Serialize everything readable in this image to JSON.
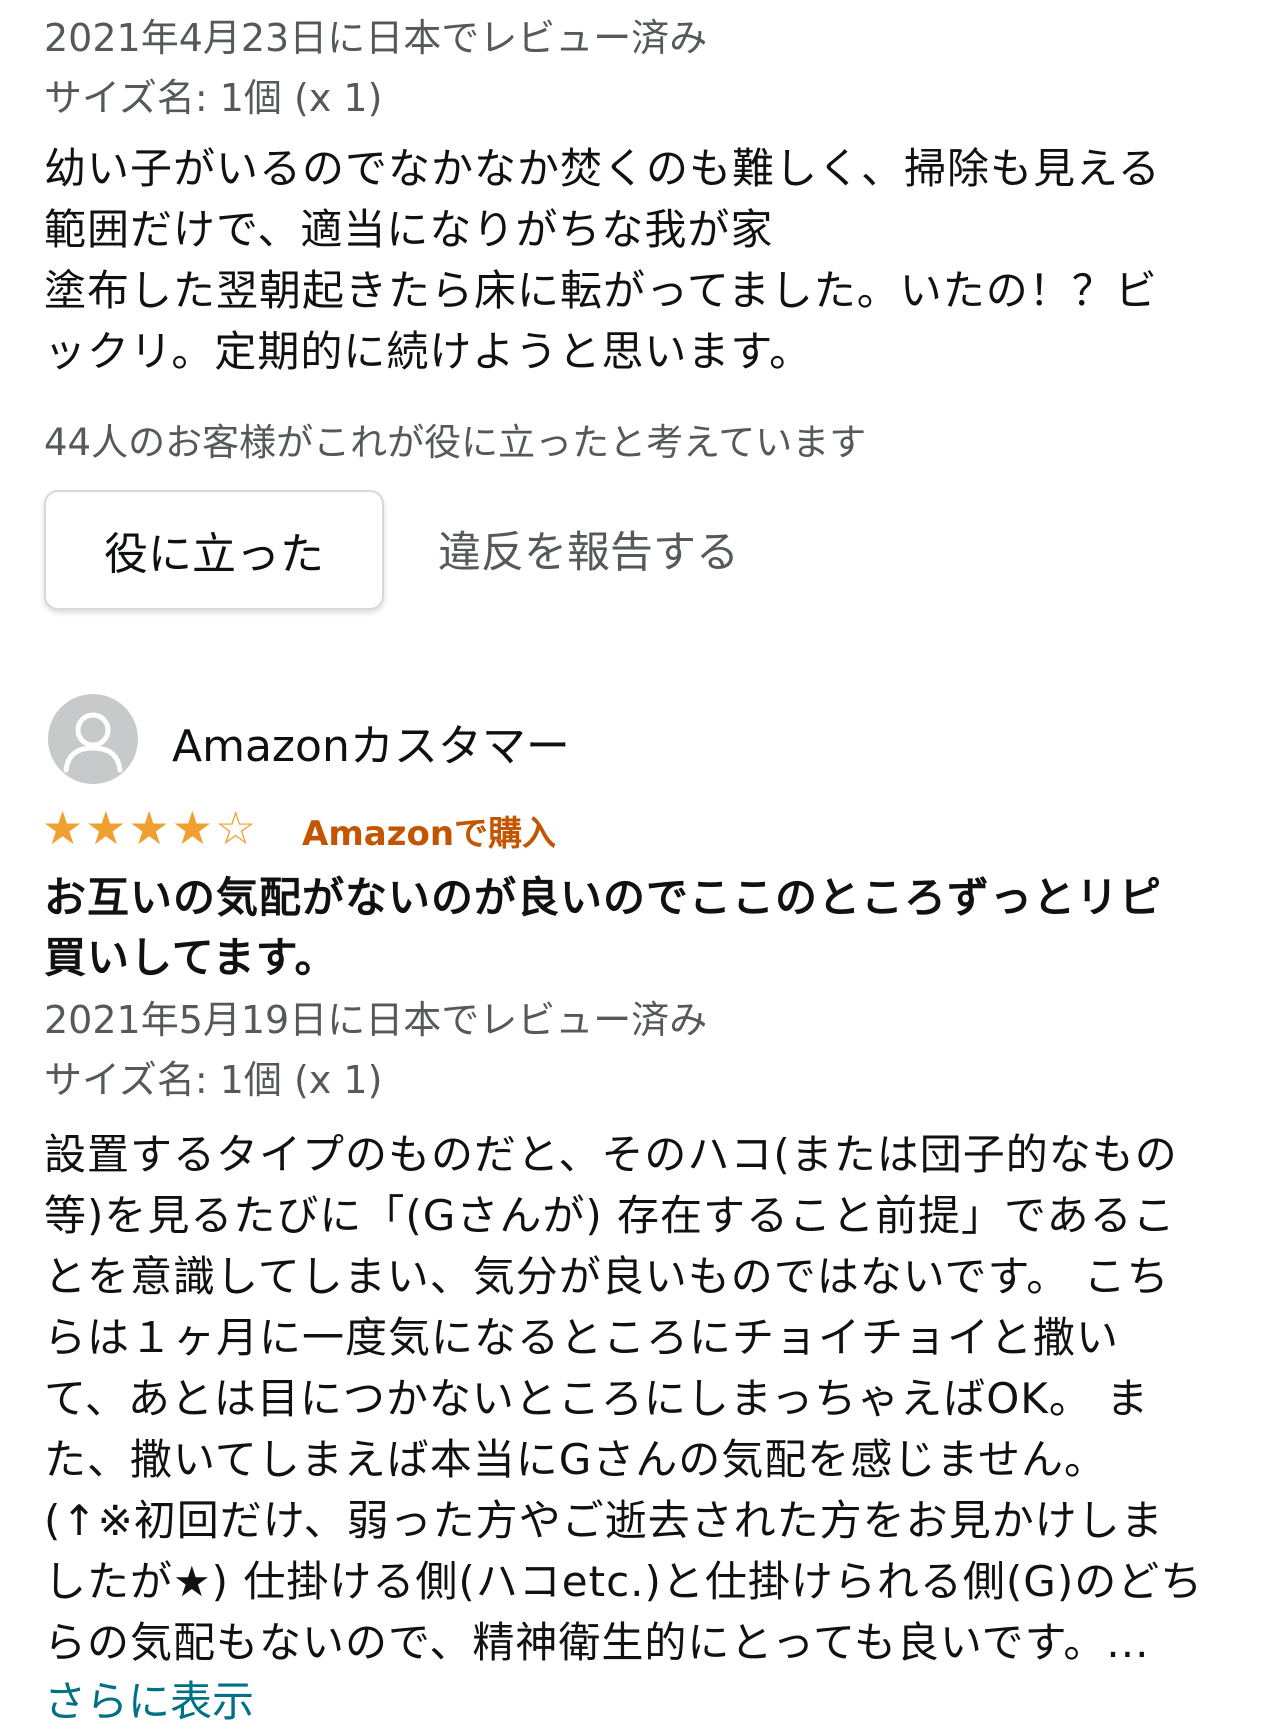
{
  "review1": {
    "date": "2021年4月23日に日本でレビュー済み",
    "size": "サイズ名: 1個 (x 1)",
    "body_lines": [
      "幼い子がいるのでなかなか焚くのも難しく、掃除も見える",
      "範囲だけで、適当になりがちな我が家",
      "塗布した翌朝起きたら床に転がってました。いたの！？ビ",
      "ックリ。定期的に続けようと思います。"
    ],
    "helpful_count": "44人のお客様がこれが役に立ったと考えています",
    "helpful_button": "役に立った",
    "report_link": "違反を報告する"
  },
  "review2": {
    "reviewer_name": "Amazonカスタマー",
    "rating": 4,
    "rating_max": 5,
    "star_color": "#f0a030",
    "verified_label": "Amazonで購入",
    "verified_color": "#c45500",
    "title_lines": [
      "お互いの気配がないのが良いのでここのところずっとリピ",
      "買いしてます。"
    ],
    "date": "2021年5月19日に日本でレビュー済み",
    "size": "サイズ名: 1個 (x 1)",
    "body_lines": [
      "設置するタイプのものだと、そのハコ(または団子的なもの",
      "等)を見るたびに「(Gさんが) 存在すること前提」であるこ",
      "とを意識してしまい、気分が良いものではないです。 こち",
      "らは１ヶ月に一度気になるところにチョイチョイと撒い",
      "て、あとは目につかないところにしまっちゃえばOK。 ま",
      "た、撒いてしまえば本当にGさんの気配を感じません。",
      "(↑※初回だけ、弱った方やご逝去された方をお見かけしま",
      "したが★) 仕掛ける側(ハコetc.)と仕掛けられる側(G)のどち",
      "らの気配もないので、精神衛生的にとっても良いです。..."
    ],
    "show_more": "さらに表示",
    "link_color": "#007185"
  }
}
